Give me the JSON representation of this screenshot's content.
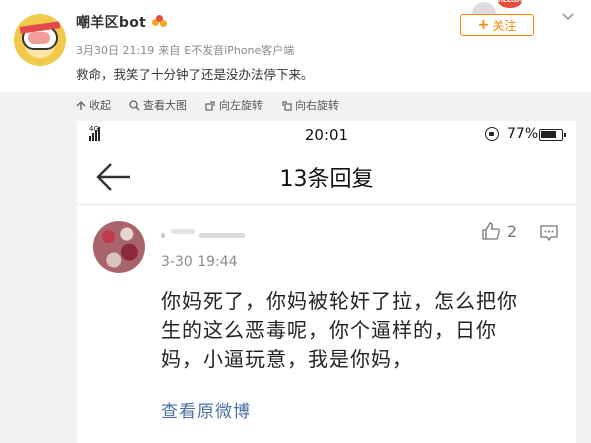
{
  "post": {
    "user_name": "嘲羊区bot",
    "date": "3月30日 21:19",
    "source_prefix": "来自",
    "source": "E不发音iPhone客户端",
    "text": "救命，我笑了十分钟了还是没办法停下来。",
    "mascot_text": "HELLO!",
    "follow_label": "关注",
    "follow_plus": "+"
  },
  "toolbar": {
    "items": [
      {
        "label": "收起",
        "icon": "collapse-arrow-icon"
      },
      {
        "label": "查看大图",
        "icon": "magnifier-icon"
      },
      {
        "label": "向左旋转",
        "icon": "rotate-left-icon"
      },
      {
        "label": "向右旋转",
        "icon": "rotate-right-icon"
      }
    ]
  },
  "phone": {
    "network": "4G",
    "time": "20:01",
    "battery": "77%",
    "title": "13条回复",
    "comment": {
      "time": "3-30 19:44",
      "likes": "2",
      "body": "你妈死了，你妈被轮奸了拉，怎么把你\n生的这么恶毒呢，你个逼样的，日你\n妈，小逼玩意，我是你妈，",
      "view_original": "查看原微博"
    }
  },
  "colors": {
    "accent_orange": "#ff8200",
    "link_blue": "#4a6fa5",
    "media_bg": "#f2f2f2"
  }
}
